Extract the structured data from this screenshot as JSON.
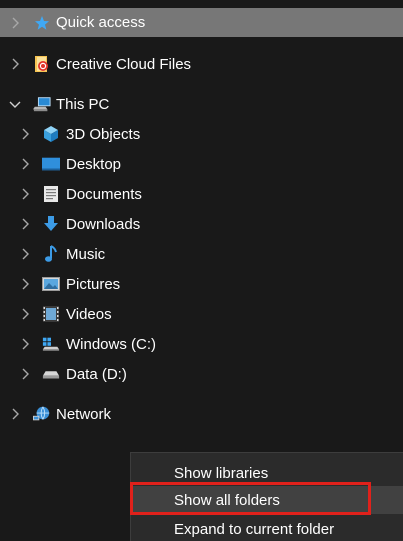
{
  "nav": {
    "quick_access": "Quick access",
    "creative_cloud": "Creative Cloud Files",
    "this_pc": "This PC",
    "children": [
      "3D Objects",
      "Desktop",
      "Documents",
      "Downloads",
      "Music",
      "Pictures",
      "Videos",
      "Windows (C:)",
      "Data (D:)"
    ],
    "network": "Network"
  },
  "context_menu": {
    "show_libraries": "Show libraries",
    "show_all_folders": "Show all folders",
    "expand_current": "Expand to current folder"
  },
  "colors": {
    "background": "#191919",
    "selection": "#777777",
    "menu_background": "#2b2b2b",
    "highlight_box": "#e0211b",
    "accent_blue": "#2a8ad4"
  }
}
